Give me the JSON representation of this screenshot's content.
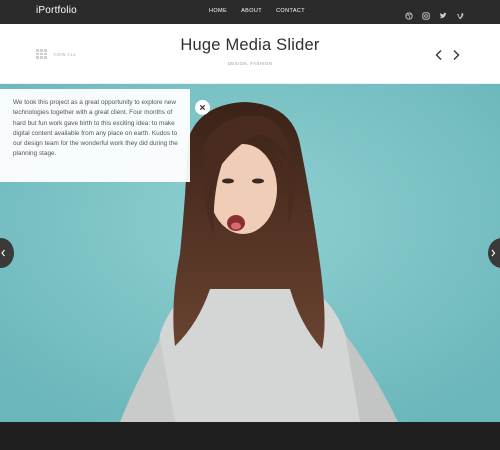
{
  "brand": "iPortfolio",
  "nav": {
    "items": [
      "HOME",
      "ABOUT",
      "CONTACT"
    ]
  },
  "social": {
    "icons": [
      "dribbble-icon",
      "instagram-icon",
      "twitter-icon",
      "vimeo-icon"
    ]
  },
  "header": {
    "view_all_label": "VIEW ALL",
    "title": "Huge Media Slider",
    "subtitle": "DESIGN, FASHION"
  },
  "slide": {
    "description": "We took this project as a great opportunity to explore new technologies together with a great client. Four months of hard but fun work gave birth to this exciting idea: to make digital content available from any place on earth. Kudos to our design team for the wonderful work they did during the planning stage.",
    "close_label": "×"
  },
  "colors": {
    "topbar": "#2b2b2b",
    "hero_background": "#7cc3c6",
    "footer": "#1f1f1f"
  }
}
